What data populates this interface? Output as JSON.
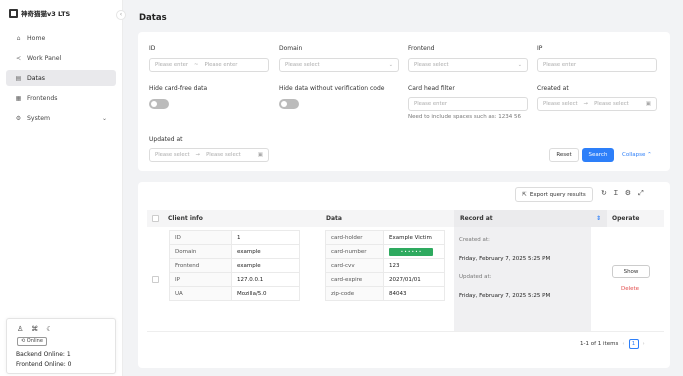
{
  "app": {
    "title": "神奇猫猫v3 LTS"
  },
  "sidebar": {
    "items": [
      {
        "label": "Home",
        "icon": "home-icon"
      },
      {
        "label": "Work Panel",
        "icon": "panel-icon"
      },
      {
        "label": "Datas",
        "icon": "data-icon",
        "active": true
      },
      {
        "label": "Frontends",
        "icon": "grid-icon"
      },
      {
        "label": "System",
        "icon": "gear-icon"
      }
    ],
    "status": {
      "online_badge": "Online",
      "backend_online": "Backend Online: 1",
      "frontend_online": "Frontend Online: 0"
    }
  },
  "page": {
    "title": "Datas"
  },
  "filters": {
    "id_label": "ID",
    "id_placeholder_start": "Please enter",
    "id_placeholder_end": "Please enter",
    "domain_label": "Domain",
    "domain_placeholder": "Please select",
    "frontend_label": "Frontend",
    "frontend_placeholder": "Please select",
    "ip_label": "IP",
    "ip_placeholder": "Please enter",
    "hide_card_free_label": "Hide card-free data",
    "hide_no_verification_label": "Hide data without verification code",
    "card_head_label": "Card head filter",
    "card_head_placeholder": "Please enter",
    "card_head_hint": "Need to include spaces such as: 1234 56",
    "created_label": "Created at",
    "created_start": "Please select",
    "created_end": "Please select",
    "updated_label": "Updated at",
    "updated_start": "Please select",
    "updated_end": "Please select",
    "reset_label": "Reset",
    "search_label": "Search",
    "collapse_label": "Collapse"
  },
  "table": {
    "export_label": "Export query results",
    "columns": {
      "client_info": "Client info",
      "data": "Data",
      "record_at": "Record at",
      "operate": "Operate"
    },
    "row": {
      "client_info": [
        {
          "key": "ID",
          "value": "1"
        },
        {
          "key": "Domain",
          "value": "example"
        },
        {
          "key": "Frontend",
          "value": "example"
        },
        {
          "key": "IP",
          "value": "127.0.0.1"
        },
        {
          "key": "UA",
          "value": "Mozilla/5.0"
        }
      ],
      "data": [
        {
          "key": "card-holder",
          "value": "Example Victim"
        },
        {
          "key": "card-number",
          "value": ""
        },
        {
          "key": "card-cvv",
          "value": "123"
        },
        {
          "key": "card-expire",
          "value": "2027/01/01"
        },
        {
          "key": "zip-code",
          "value": "84043"
        }
      ],
      "created_label": "Created at:",
      "created_value": "Friday, February 7, 2025 5:25 PM",
      "updated_label": "Updated at:",
      "updated_value": "Friday, February 7, 2025 5:25 PM",
      "show_label": "Show",
      "delete_label": "Delete"
    },
    "pagination": {
      "summary": "1-1 of 1 items",
      "current_page": "1"
    }
  },
  "colors": {
    "primary": "#2d7ff9",
    "danger": "#e34d4d",
    "card_number_fill": "#2eaa5f"
  }
}
